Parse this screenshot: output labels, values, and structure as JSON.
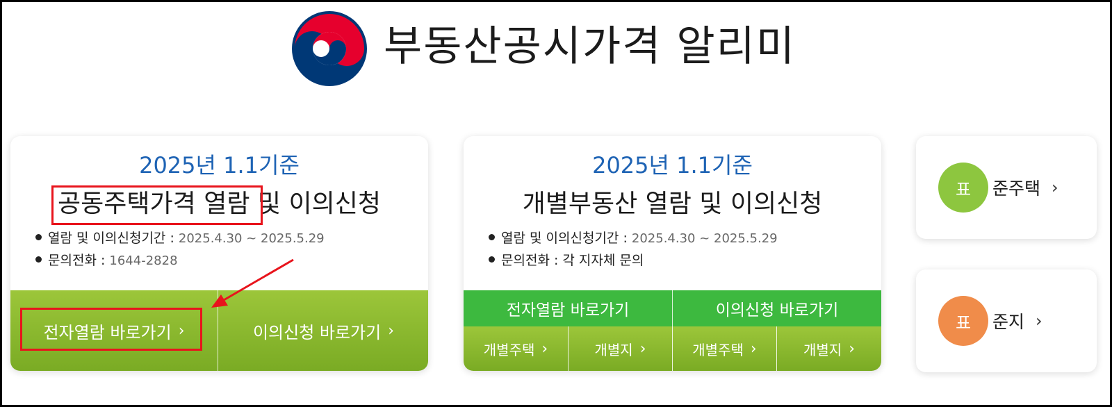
{
  "header": {
    "site_title": "부동산공시가격 알리미",
    "logo_icon": "taegeuk-logo-icon"
  },
  "cards": {
    "apartment": {
      "year_label": "2025년 1.1기준",
      "title_part1": "공동주택가격 열람",
      "title_part2": " 및 이의신청",
      "period_label": "열람 및 이의신청기간 : ",
      "period_value": "2025.4.30 ~ 2025.5.29",
      "contact_label": "문의전화 : ",
      "contact_value": "1644-2828",
      "view_button": "전자열람 바로가기",
      "objection_button": "이의신청 바로가기"
    },
    "individual": {
      "year_label": "2025년 1.1기준",
      "title": "개별부동산 열람 및 이의신청",
      "period_label": "열람 및 이의신청기간 : ",
      "period_value": "2025.4.30 ~ 2025.5.29",
      "contact_label": "문의전화 : ",
      "contact_value": "각 지자체 문의",
      "view_header": "전자열람 바로가기",
      "objection_header": "이의신청 바로가기",
      "view_house": "개별주택",
      "view_land": "개별지",
      "objection_house": "개별주택",
      "objection_land": "개별지"
    }
  },
  "quick_links": {
    "standard_house": {
      "badge": "표",
      "label": "준주택",
      "color": "#8dc63f"
    },
    "standard_land": {
      "badge": "표",
      "label": "준지",
      "color": "#f08c4a"
    }
  },
  "chevron": "›",
  "colors": {
    "accent_blue": "#1e63b4",
    "card_green": "#8cbb2f",
    "bar_green": "#3db93f",
    "annotation_red": "#e8141c"
  }
}
